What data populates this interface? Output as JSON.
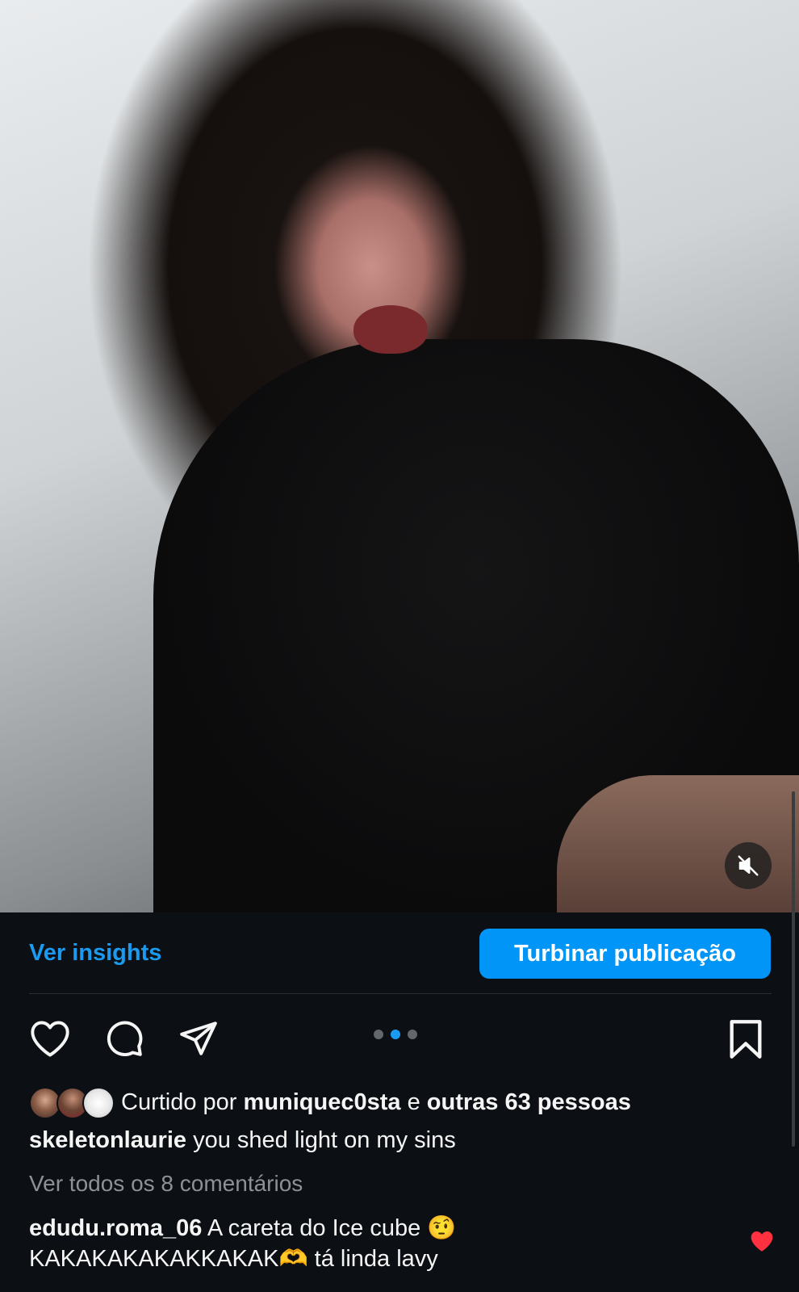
{
  "post": {
    "insights_label": "Ver insights",
    "boost_label": "Turbinar publicação",
    "carousel": {
      "count": 3,
      "active_index": 1
    },
    "likes": {
      "prefix": "Curtido por",
      "user": "muniquec0sta",
      "connector": "e",
      "others": "outras 63 pessoas"
    },
    "caption": {
      "username": "skeletonlaurie",
      "text": "you shed light on my sins"
    },
    "view_comments_label": "Ver todos os 8 comentários",
    "comments": [
      {
        "username": "edudu.roma_06",
        "text_line1": "A careta do Ice cube 🤨",
        "text_line2": "KAKAKAKAKAKKAKAK🫶 tá linda lavy",
        "liked": true
      }
    ]
  },
  "icons": {
    "mute": "speaker-muted-icon",
    "like": "heart-outline-icon",
    "comment": "comment-bubble-icon",
    "share": "paper-plane-icon",
    "save": "bookmark-icon",
    "comment_like": "heart-filled-icon"
  },
  "colors": {
    "background": "#0c1014",
    "accent_blue": "#0095f6",
    "link_blue": "#1a9bf0",
    "muted_text": "#8d9196",
    "heart_red": "#ff3040"
  }
}
